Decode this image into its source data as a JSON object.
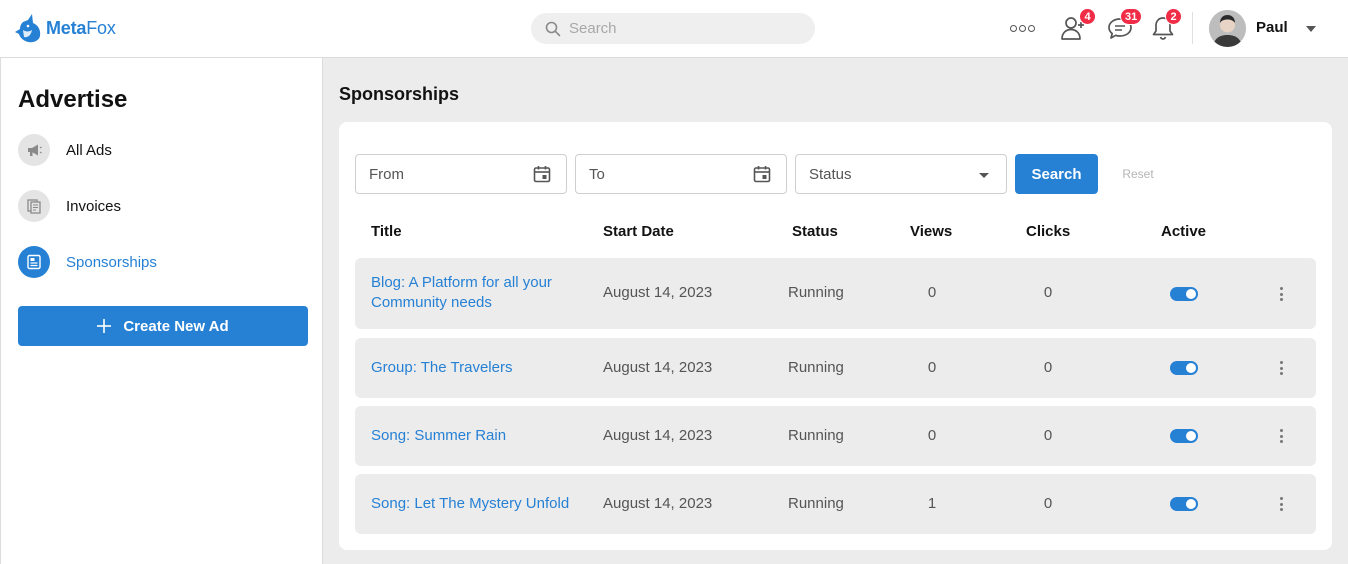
{
  "header": {
    "logo_bold": "Meta",
    "logo_thin": "Fox",
    "search_placeholder": "Search",
    "friend_requests_count": "4",
    "messages_count": "31",
    "notifications_count": "2",
    "user_name": "Paul"
  },
  "sidebar": {
    "title": "Advertise",
    "items": [
      {
        "label": "All Ads",
        "icon": "megaphone-icon",
        "active": false
      },
      {
        "label": "Invoices",
        "icon": "invoice-icon",
        "active": false
      },
      {
        "label": "Sponsorships",
        "icon": "sponsorship-icon",
        "active": true
      }
    ],
    "create_label": "Create New Ad"
  },
  "main": {
    "title": "Sponsorships",
    "filters": {
      "from_placeholder": "From",
      "to_placeholder": "To",
      "status_placeholder": "Status",
      "search_label": "Search",
      "reset_label": "Reset"
    },
    "columns": [
      "Title",
      "Start Date",
      "Status",
      "Views",
      "Clicks",
      "Active"
    ],
    "rows": [
      {
        "title": "Blog: A Platform for all your Community needs",
        "start_date": "August 14, 2023",
        "status": "Running",
        "views": "0",
        "clicks": "0",
        "active": true
      },
      {
        "title": "Group: The Travelers",
        "start_date": "August 14, 2023",
        "status": "Running",
        "views": "0",
        "clicks": "0",
        "active": true
      },
      {
        "title": "Song: Summer Rain",
        "start_date": "August 14, 2023",
        "status": "Running",
        "views": "0",
        "clicks": "0",
        "active": true
      },
      {
        "title": "Song: Let The Mystery Unfold",
        "start_date": "August 14, 2023",
        "status": "Running",
        "views": "1",
        "clicks": "0",
        "active": true
      }
    ]
  },
  "colors": {
    "primary": "#2681d5",
    "badge": "#f02c46",
    "row_bg": "#ececec"
  }
}
